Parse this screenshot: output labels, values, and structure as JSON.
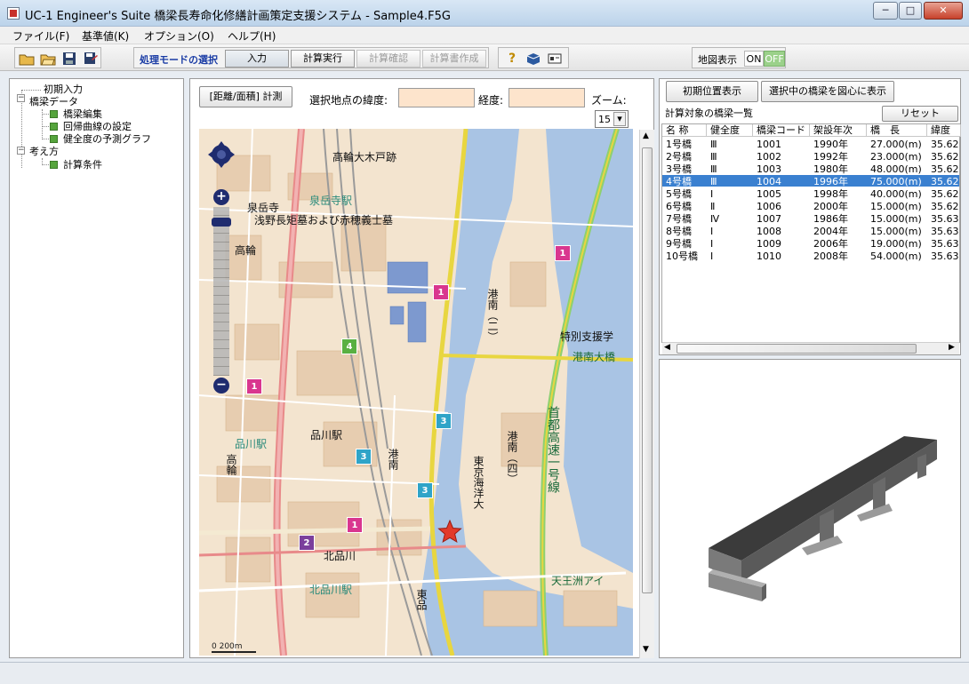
{
  "window": {
    "title": "UC-1 Engineer's Suite 橋梁長寿命化修繕計画策定支援システム - Sample4.F5G",
    "minimize": "─",
    "maximize": "□",
    "close": "✕"
  },
  "menu": [
    "ファイル(F)",
    "基準値(K)",
    "オプション(O)",
    "ヘルプ(H)"
  ],
  "toolbar": {
    "icons": [
      "open-icon",
      "open-folder-icon",
      "save-icon",
      "save-as-icon"
    ],
    "mode_label": "処理モードの選択",
    "modes": [
      {
        "label": "入力",
        "state": "enabled"
      },
      {
        "label": "計算実行",
        "state": "enabled"
      },
      {
        "label": "計算確認",
        "state": "disabled"
      },
      {
        "label": "計算書作成",
        "state": "disabled"
      }
    ],
    "help_icons": [
      "help-icon",
      "box-icon",
      "card-icon"
    ],
    "map_display_label": "地図表示",
    "on_label": "ON",
    "off_label": "OFF"
  },
  "tree": [
    {
      "label": "初期入力",
      "level": 1,
      "kind": "node"
    },
    {
      "label": "橋梁データ",
      "level": 0,
      "kind": "group"
    },
    {
      "label": "橋梁編集",
      "level": 2,
      "kind": "leaf"
    },
    {
      "label": "回帰曲線の設定",
      "level": 2,
      "kind": "leaf"
    },
    {
      "label": "健全度の予測グラフ",
      "level": 2,
      "kind": "leaf"
    },
    {
      "label": "考え方",
      "level": 0,
      "kind": "group"
    },
    {
      "label": "計算条件",
      "level": 2,
      "kind": "leaf"
    }
  ],
  "map_panel": {
    "measure_button": "[距離/面積] 計測",
    "lat_label": "選択地点の緯度:",
    "lat_value": "",
    "lng_label": "経度:",
    "lng_value": "",
    "zoom_label": "ズーム:",
    "zoom_value": "15",
    "places": [
      {
        "text": "高輪大木戸跡"
      },
      {
        "text": "泉岳寺駅"
      },
      {
        "text": "泉岳寺"
      },
      {
        "text": "浅野長矩墓および赤穂義士墓"
      },
      {
        "text": "高輪"
      },
      {
        "text": "品川駅"
      },
      {
        "text": "品川駅"
      },
      {
        "text": "北品川駅"
      },
      {
        "text": "北品川"
      },
      {
        "text": "港南"
      },
      {
        "text": "港南（二）"
      },
      {
        "text": "港南（四）"
      },
      {
        "text": "東京海洋大"
      },
      {
        "text": "首都高速一号線"
      },
      {
        "text": "港南大橋"
      },
      {
        "text": "特別支援学"
      },
      {
        "text": "天王洲アイ"
      },
      {
        "text": "東品"
      },
      {
        "text": "高輪"
      }
    ],
    "markers": [
      {
        "label": "1",
        "color": "#d9368f"
      },
      {
        "label": "1",
        "color": "#d9368f"
      },
      {
        "label": "1",
        "color": "#d9368f"
      },
      {
        "label": "1",
        "color": "#d9368f"
      },
      {
        "label": "2",
        "color": "#7b3f9c"
      },
      {
        "label": "3",
        "color": "#2fa4c8"
      },
      {
        "label": "3",
        "color": "#2fa4c8"
      },
      {
        "label": "3",
        "color": "#2fa4c8"
      },
      {
        "label": "4",
        "color": "#59b042"
      }
    ],
    "selected_marker": "star-icon",
    "zoom_control": {
      "plus": "+",
      "minus": "−",
      "scale_text": "0 200m"
    }
  },
  "right_panel": {
    "initial_position_button": "初期位置表示",
    "center_button": "選択中の橋梁を図心に表示",
    "list_label": "計算対象の橋梁一覧",
    "reset_button": "リセット",
    "columns": [
      "名 称",
      "健全度",
      "橋梁コード",
      "架設年次",
      "橋　長",
      "緯度"
    ],
    "rows": [
      [
        "1号橋",
        "Ⅲ",
        "1001",
        "1990年",
        "27.000(m)",
        "35.62..."
      ],
      [
        "2号橋",
        "Ⅲ",
        "1002",
        "1992年",
        "23.000(m)",
        "35.62..."
      ],
      [
        "3号橋",
        "Ⅲ",
        "1003",
        "1980年",
        "48.000(m)",
        "35.62..."
      ],
      [
        "4号橋",
        "Ⅲ",
        "1004",
        "1996年",
        "75.000(m)",
        "35.62..."
      ],
      [
        "5号橋",
        "Ⅰ",
        "1005",
        "1998年",
        "40.000(m)",
        "35.62..."
      ],
      [
        "6号橋",
        "Ⅱ",
        "1006",
        "2000年",
        "15.000(m)",
        "35.62..."
      ],
      [
        "7号橋",
        "Ⅳ",
        "1007",
        "1986年",
        "15.000(m)",
        "35.63..."
      ],
      [
        "8号橋",
        "Ⅰ",
        "1008",
        "2004年",
        "15.000(m)",
        "35.63..."
      ],
      [
        "9号橋",
        "Ⅰ",
        "1009",
        "2006年",
        "19.000(m)",
        "35.63..."
      ],
      [
        "10号橋",
        "Ⅰ",
        "1010",
        "2008年",
        "54.000(m)",
        "35.63..."
      ]
    ],
    "selected_row": 3
  },
  "colors": {
    "selection": "#3a80d0",
    "input_bg": "#fde4cc",
    "leaf": "#55a43c",
    "on_off_active": "#9bd18a"
  }
}
